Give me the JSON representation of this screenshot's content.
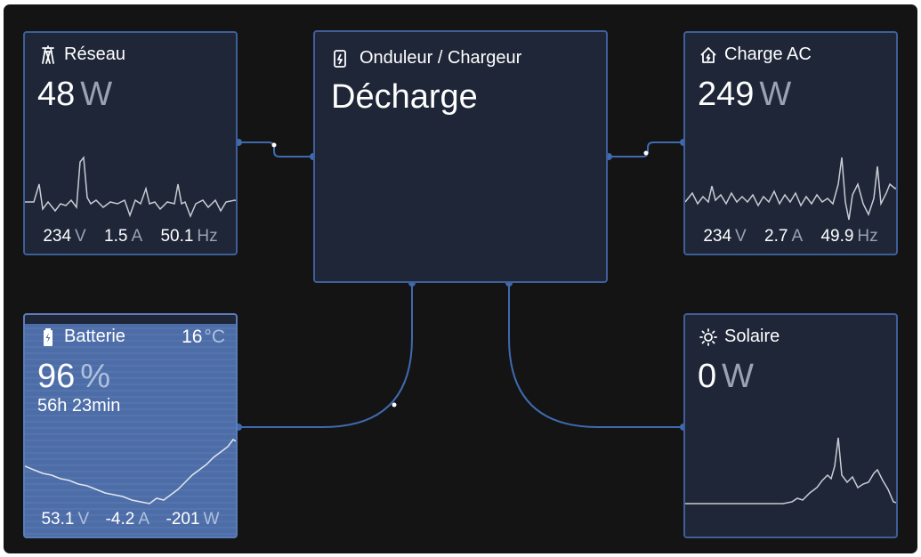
{
  "reseau": {
    "title": "Réseau",
    "power_value": "48",
    "power_unit": "W",
    "voltage": "234",
    "voltage_unit": "V",
    "current": "1.5",
    "current_unit": "A",
    "frequency": "50.1",
    "frequency_unit": "Hz"
  },
  "onduleur": {
    "title": "Onduleur / Chargeur",
    "state": "Décharge"
  },
  "charge_ac": {
    "title": "Charge AC",
    "power_value": "249",
    "power_unit": "W",
    "voltage": "234",
    "voltage_unit": "V",
    "current": "2.7",
    "current_unit": "A",
    "frequency": "49.9",
    "frequency_unit": "Hz"
  },
  "batterie": {
    "title": "Batterie",
    "temperature": "16",
    "temperature_unit": "°C",
    "soc_value": "96",
    "soc_unit": "%",
    "time_remaining": "56h 23min",
    "voltage": "53.1",
    "voltage_unit": "V",
    "current": "-4.2",
    "current_unit": "A",
    "power": "-201",
    "power_unit": "W",
    "fill_level": 0.96
  },
  "solaire": {
    "title": "Solaire",
    "power_value": "0",
    "power_unit": "W"
  },
  "icons": {
    "reseau": "power-tower-icon",
    "onduleur": "inverter-icon",
    "charge_ac": "home-icon",
    "batterie": "battery-icon",
    "solaire": "sun-icon"
  },
  "colors": {
    "background": "#141414",
    "tile": "#1e2638",
    "tile_border": "#3e5f9a",
    "battery_fill": "#4d6da8",
    "secondary_text": "#9aa3b2"
  }
}
